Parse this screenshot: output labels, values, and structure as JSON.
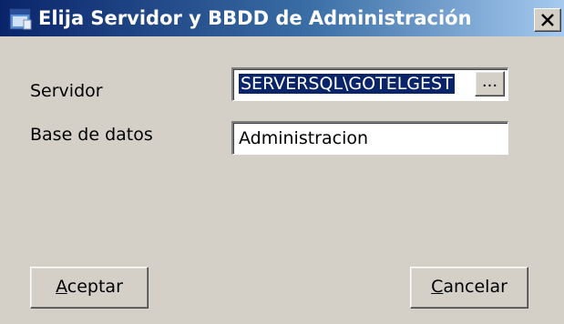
{
  "window": {
    "title": "Elija Servidor y BBDD de Administración",
    "close_glyph": "✕"
  },
  "form": {
    "server_label": "Servidor",
    "server_value": "SERVERSQL\\GOTELGEST",
    "browse_label": "...",
    "database_label": "Base de datos",
    "database_value": "Administracion"
  },
  "buttons": {
    "accept": {
      "mnemonic": "A",
      "rest": "ceptar"
    },
    "cancel": {
      "mnemonic": "C",
      "rest": "ancelar"
    }
  },
  "colors": {
    "title_bar_start": "#0a246a",
    "title_bar_end": "#a6caf0",
    "selection": "#0a246a",
    "dialog_bg": "#d4d0c8"
  }
}
